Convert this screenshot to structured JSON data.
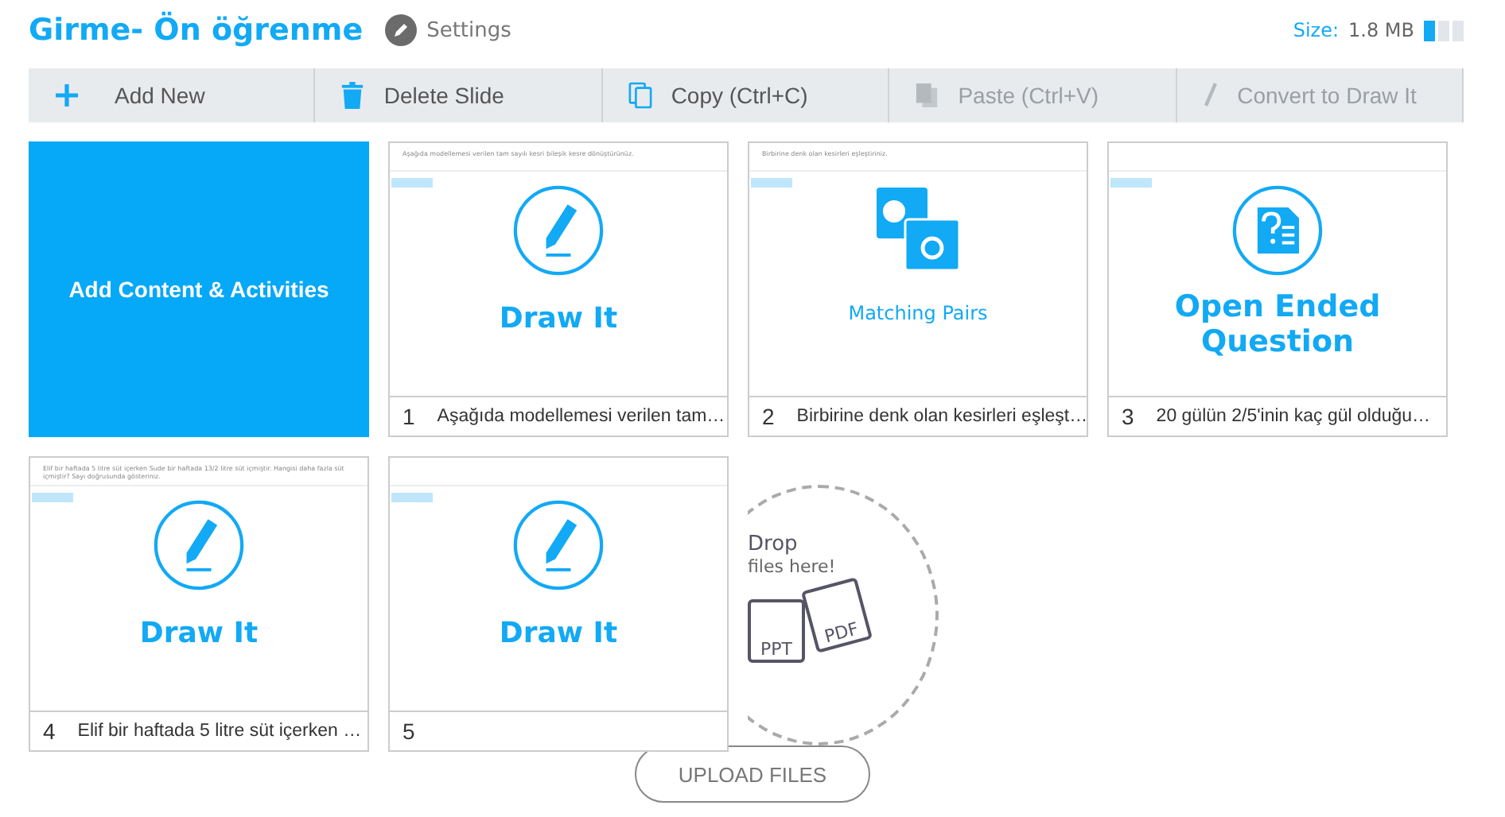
{
  "header": {
    "title": "Girme- Ön öğrenme",
    "settings": "Settings",
    "size_label": "Size:",
    "size_value": "1.8 MB",
    "meter": {
      "level": 0.33
    }
  },
  "toolbar": [
    {
      "kind": "add",
      "label": "Add New",
      "disabled": false
    },
    {
      "kind": "delete",
      "label": "Delete Slide",
      "disabled": false
    },
    {
      "kind": "copy",
      "label": "Copy (Ctrl+C)",
      "disabled": false
    },
    {
      "kind": "paste",
      "label": "Paste (Ctrl+V)",
      "disabled": true
    },
    {
      "kind": "convert",
      "label": "Convert to Draw It",
      "disabled": true
    }
  ],
  "slides": [
    {
      "kind": "add",
      "label": "Add Content & Activities"
    },
    {
      "kind": "draw",
      "label": "Draw It",
      "number": "1",
      "caption": "Aşağıda modellemesi verilen tam…",
      "preview": "Aşağıda modellemesi verilen tam sayılı kesri bileşik kesre dönüştürünüz."
    },
    {
      "kind": "matching",
      "label": "Matching Pairs",
      "number": "2",
      "caption": "Birbirine denk olan kesirleri eşleşt…",
      "preview": "Birbirine denk olan kesirleri eşleştiriniz."
    },
    {
      "kind": "open",
      "label": "Open Ended Question",
      "number": "3",
      "caption": "20 gülün 2/5'inin kaç gül olduğu…"
    },
    {
      "kind": "draw",
      "label": "Draw It",
      "number": "4",
      "caption": "Elif bir haftada 5 litre süt içerken …",
      "preview": "Elif bir haftada 5 litre süt içerken Sude bir haftada 13/2 litre süt içmiştir. Hangisi daha fazla süt içmiştir? Sayı doğrusunda gösteriniz."
    },
    {
      "kind": "draw",
      "label": "Draw It",
      "number": "5"
    }
  ],
  "dropzone": {
    "title": "Drop",
    "subtitle": "files here!",
    "ppt": "PPT",
    "pdf": "PDF",
    "button": "UPLOAD FILES"
  }
}
